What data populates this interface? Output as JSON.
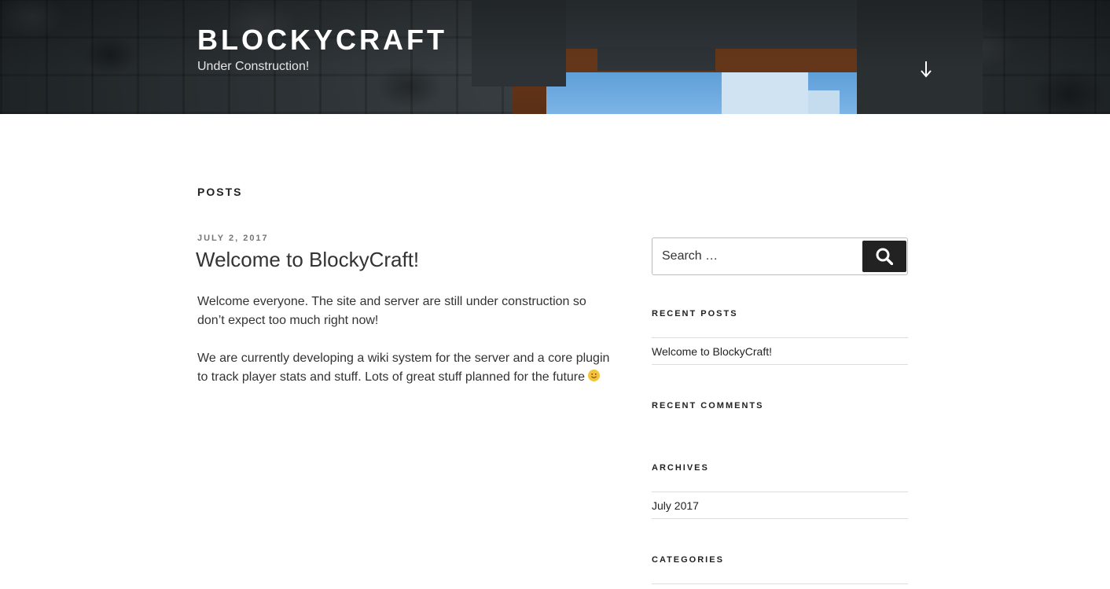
{
  "header": {
    "site_title": "BlockyCraft",
    "site_description": "Under Construction!",
    "scroll_icon": "arrow-down-icon"
  },
  "main": {
    "page_title": "Posts",
    "post": {
      "date": "July 2, 2017",
      "title": "Welcome to BlockyCraft!",
      "paragraphs": [
        "Welcome everyone. The site and server are still under construction so don’t expect too much right now!",
        "We are currently developing a wiki system for the server and a core plugin to track player stats and stuff. Lots of great stuff planned for the future"
      ],
      "emoji": "slightly-smiling-face"
    }
  },
  "sidebar": {
    "search": {
      "placeholder": "Search …",
      "button_icon": "search-icon"
    },
    "recent_posts": {
      "title": "Recent Posts",
      "items": [
        "Welcome to BlockyCraft!"
      ]
    },
    "recent_comments": {
      "title": "Recent Comments",
      "items": []
    },
    "archives": {
      "title": "Archives",
      "items": [
        "July 2017"
      ]
    },
    "categories": {
      "title": "Categories"
    }
  },
  "colors": {
    "text": "#222222",
    "muted": "#767676",
    "button_bg": "#222222",
    "header_text": "#ffffff"
  }
}
